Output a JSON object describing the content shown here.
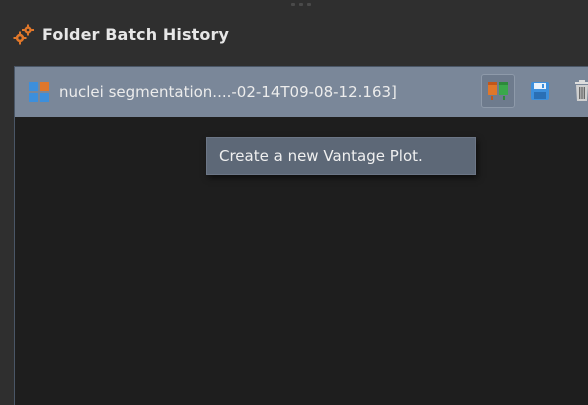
{
  "panel": {
    "title": "Folder Batch History",
    "icon": "gear-icon"
  },
  "batch_item": {
    "label": "nuclei segmentation....-02-14T09-08-12.163]",
    "icon": "batch-grid-icon",
    "actions": [
      {
        "name": "create-vantage-plot-button",
        "icon": "vantage-plot-icon"
      },
      {
        "name": "save-button",
        "icon": "floppy-disk-icon"
      },
      {
        "name": "delete-button",
        "icon": "trash-icon"
      }
    ]
  },
  "tooltip": {
    "text": "Create a new Vantage Plot."
  },
  "colors": {
    "accent_orange": "#e0772a",
    "accent_blue": "#3d8fdc",
    "row_bg": "#7a8799",
    "content_bg": "#1e1e1e",
    "panel_bg": "#2f2f2f"
  }
}
